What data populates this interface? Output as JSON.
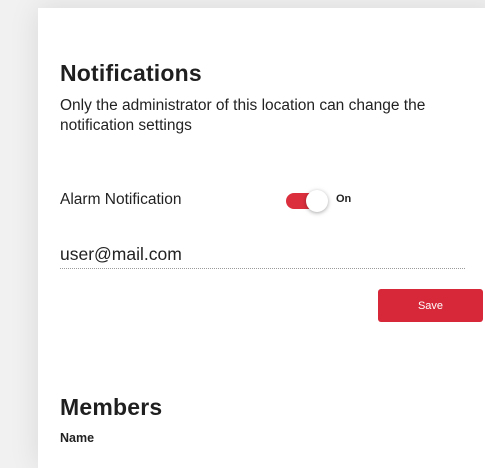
{
  "notifications": {
    "title": "Notifications",
    "description": "Only the administrator of this location can change the notification settings",
    "alarm": {
      "label": "Alarm Notification",
      "state_label": "On",
      "enabled": true
    },
    "email": {
      "value": "user@mail.com"
    },
    "save_label": "Save"
  },
  "members": {
    "title": "Members",
    "columns": [
      "Name"
    ]
  },
  "colors": {
    "accent": "#d62839",
    "toggle_on": "#dc2f3e",
    "card_background": "#ffffff",
    "page_background": "#f1f1f1"
  }
}
